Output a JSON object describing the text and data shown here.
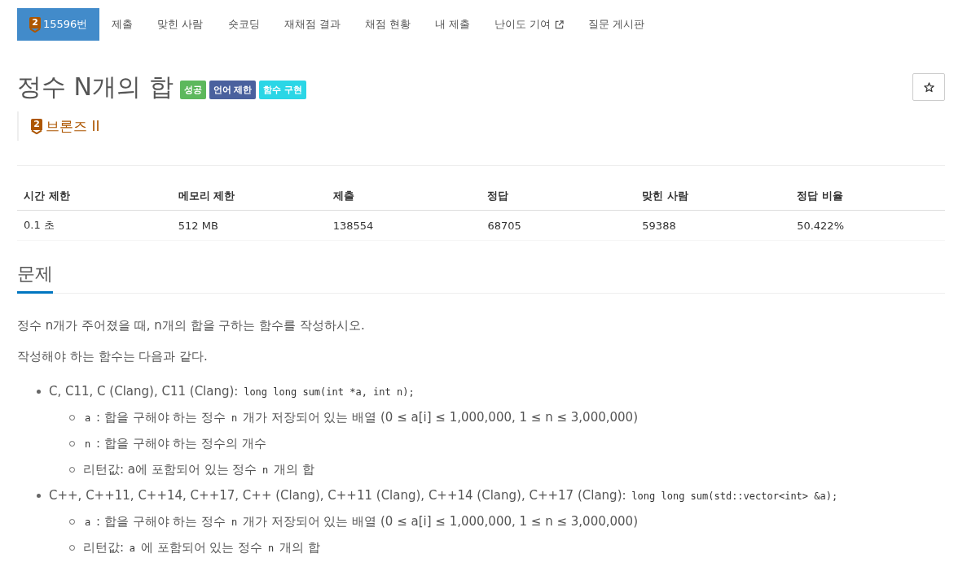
{
  "nav": {
    "items": [
      {
        "label": "15596번",
        "kind": "problem",
        "tier_level": "2",
        "selected": true
      },
      {
        "label": "제출",
        "kind": "link",
        "selected": false
      },
      {
        "label": "맞힌 사람",
        "kind": "link",
        "selected": false
      },
      {
        "label": "숏코딩",
        "kind": "link",
        "selected": false
      },
      {
        "label": "재채점 결과",
        "kind": "link",
        "selected": false
      },
      {
        "label": "채점 현황",
        "kind": "link",
        "selected": false
      },
      {
        "label": "내 제출",
        "kind": "link",
        "selected": false
      },
      {
        "label": "난이도 기여",
        "kind": "external",
        "selected": false
      },
      {
        "label": "질문 게시판",
        "kind": "link",
        "selected": false
      }
    ]
  },
  "problem": {
    "title": "정수 N개의 합",
    "labels": [
      {
        "text": "성공",
        "color": "#5cb85c"
      },
      {
        "text": "언어 제한",
        "color": "#4a619e"
      },
      {
        "text": "함수 구현",
        "color": "#2bd6e6"
      }
    ],
    "starred": false,
    "tier": {
      "level": "2",
      "name": "브론즈 II"
    }
  },
  "stats": {
    "columns": [
      "시간 제한",
      "메모리 제한",
      "제출",
      "정답",
      "맞힌 사람",
      "정답 비율"
    ],
    "rows": [
      [
        "0.1 초",
        "512 MB",
        "138554",
        "68705",
        "59388",
        "50.422%"
      ]
    ]
  },
  "section": {
    "heading": "문제",
    "paragraphs": [
      "정수 n개가 주어졌을 때, n개의 합을 구하는 함수를 작성하시오.",
      "작성해야 하는 함수는 다음과 같다."
    ],
    "list": [
      {
        "segments": [
          {
            "kind": "text",
            "text": "C, C11, C (Clang), C11 (Clang): "
          },
          {
            "kind": "code",
            "text": "long long sum(int *a, int n);"
          }
        ],
        "children": [
          {
            "segments": [
              {
                "kind": "code",
                "text": "a"
              },
              {
                "kind": "text",
                "text": " : 합을 구해야 하는 정수 "
              },
              {
                "kind": "code",
                "text": "n"
              },
              {
                "kind": "text",
                "text": " 개가 저장되어 있는 배열 (0 ≤ a[i] ≤ 1,000,000, 1 ≤ n ≤ 3,000,000)"
              }
            ]
          },
          {
            "segments": [
              {
                "kind": "code",
                "text": "n"
              },
              {
                "kind": "text",
                "text": " : 합을 구해야 하는 정수의 개수"
              }
            ]
          },
          {
            "segments": [
              {
                "kind": "text",
                "text": "리턴값: a에 포함되어 있는 정수 "
              },
              {
                "kind": "code",
                "text": "n"
              },
              {
                "kind": "text",
                "text": " 개의 합"
              }
            ]
          }
        ]
      },
      {
        "segments": [
          {
            "kind": "text",
            "text": "C++, C++11, C++14, C++17, C++ (Clang), C++11 (Clang), C++14 (Clang), C++17 (Clang): "
          },
          {
            "kind": "code",
            "text": "long long sum(std::vector<int> &a);"
          }
        ],
        "children": [
          {
            "segments": [
              {
                "kind": "code",
                "text": "a"
              },
              {
                "kind": "text",
                "text": " : 합을 구해야 하는 정수 "
              },
              {
                "kind": "code",
                "text": "n"
              },
              {
                "kind": "text",
                "text": " 개가 저장되어 있는 배열 (0 ≤ a[i] ≤ 1,000,000, 1 ≤ n ≤ 3,000,000)"
              }
            ]
          },
          {
            "segments": [
              {
                "kind": "text",
                "text": "리턴값: "
              },
              {
                "kind": "code",
                "text": "a"
              },
              {
                "kind": "text",
                "text": " 에 포함되어 있는 정수 "
              },
              {
                "kind": "code",
                "text": "n"
              },
              {
                "kind": "text",
                "text": " 개의 합"
              }
            ]
          }
        ]
      }
    ]
  }
}
